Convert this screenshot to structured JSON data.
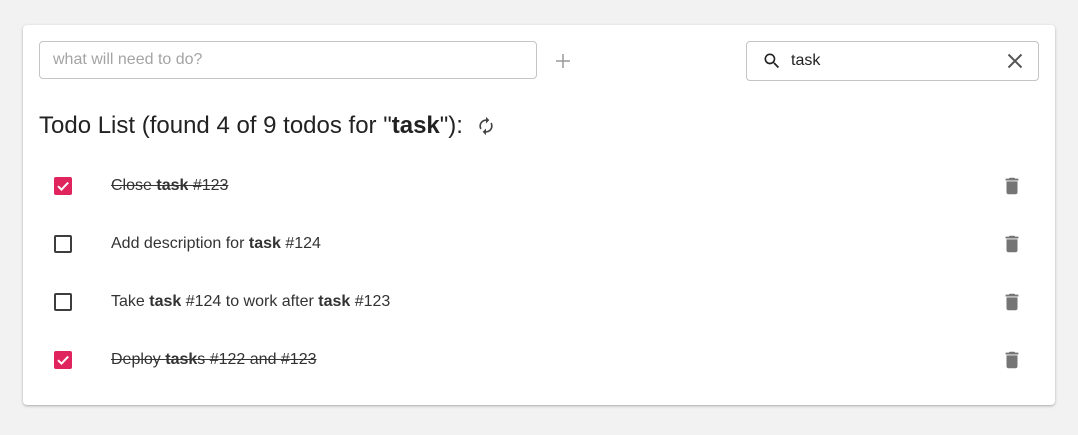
{
  "new_todo": {
    "placeholder": "what will need to do?",
    "value": ""
  },
  "add_button": {
    "icon": "plus-icon"
  },
  "search": {
    "value": "task",
    "icon": "search-icon",
    "clear_icon": "close-icon"
  },
  "title": {
    "prefix": "Todo List (found 4 of 9 todos for \"",
    "query": "task",
    "suffix": "\"):",
    "refresh_icon": "refresh-icon"
  },
  "todos": [
    {
      "done": true,
      "parts": [
        {
          "t": "Close "
        },
        {
          "t": "task",
          "b": true
        },
        {
          "t": " #123"
        }
      ]
    },
    {
      "done": false,
      "parts": [
        {
          "t": "Add description for "
        },
        {
          "t": "task",
          "b": true
        },
        {
          "t": " #124"
        }
      ]
    },
    {
      "done": false,
      "parts": [
        {
          "t": "Take "
        },
        {
          "t": "task",
          "b": true
        },
        {
          "t": " #124 to work after "
        },
        {
          "t": "task",
          "b": true
        },
        {
          "t": " #123"
        }
      ]
    },
    {
      "done": true,
      "parts": [
        {
          "t": "Deploy "
        },
        {
          "t": "task",
          "b": true
        },
        {
          "t": "s #122 and #123"
        }
      ]
    }
  ],
  "colors": {
    "checked": "#e0245e",
    "icon": "#757575",
    "background": "#f2f2f2"
  }
}
